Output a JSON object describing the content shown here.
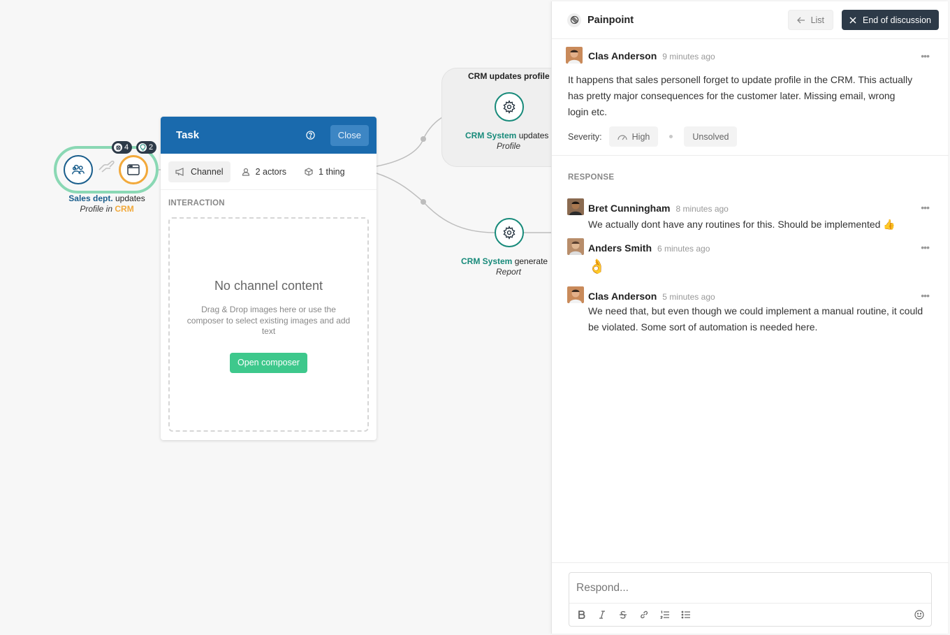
{
  "canvas": {
    "actor_node": {
      "badge_painpoints": "4",
      "badge_ideas": "2",
      "label_subject": "Sales dept.",
      "label_verb": "updates",
      "label_object": "Profile",
      "label_in": "in",
      "label_system": "CRM"
    },
    "group": {
      "title": "CRM updates profile"
    },
    "node_update": {
      "subject": "CRM System",
      "verb": "updates",
      "object": "Profile"
    },
    "node_report": {
      "subject": "CRM System",
      "verb": "generate",
      "object": "Report"
    }
  },
  "task": {
    "title": "Task",
    "close_label": "Close",
    "tabs": [
      {
        "label": "Channel",
        "icon": "megaphone-icon"
      },
      {
        "label": "2 actors",
        "icon": "user-icon"
      },
      {
        "label": "1 thing",
        "icon": "box-icon"
      }
    ],
    "section_label": "INTERACTION",
    "empty_title": "No channel content",
    "empty_text": "Drag & Drop images here or use the composer to select existing images and add text",
    "open_composer": "Open composer"
  },
  "panel": {
    "title": "Painpoint",
    "list_label": "List",
    "end_label": "End of discussion",
    "main_comment": {
      "author": "Clas Anderson",
      "time": "9 minutes ago",
      "text": "It happens that sales personell forget to update profile in the CRM. This actually has pretty major consequences for the customer later. Missing email, wrong login etc."
    },
    "severity_label": "Severity:",
    "severity_value": "High",
    "status_value": "Unsolved",
    "response_label": "RESPONSE",
    "responses": [
      {
        "author": "Bret Cunningham",
        "time": "8 minutes ago",
        "text": "We actually dont have any routines for this. Should be implemented 👍"
      },
      {
        "author": "Anders Smith",
        "time": "6 minutes ago",
        "text": "👌"
      },
      {
        "author": "Clas Anderson",
        "time": "5 minutes ago",
        "text": "We need that, but even though we could implement a manual routine, it could be violated. Some sort of automation is needed here."
      }
    ],
    "composer_placeholder": "Respond...",
    "more_label": "•••"
  },
  "colors": {
    "accent_blue": "#1a6aad",
    "teal": "#178a7a",
    "orange": "#f2a93b",
    "green": "#3ec88c",
    "dark": "#2d3a48"
  }
}
